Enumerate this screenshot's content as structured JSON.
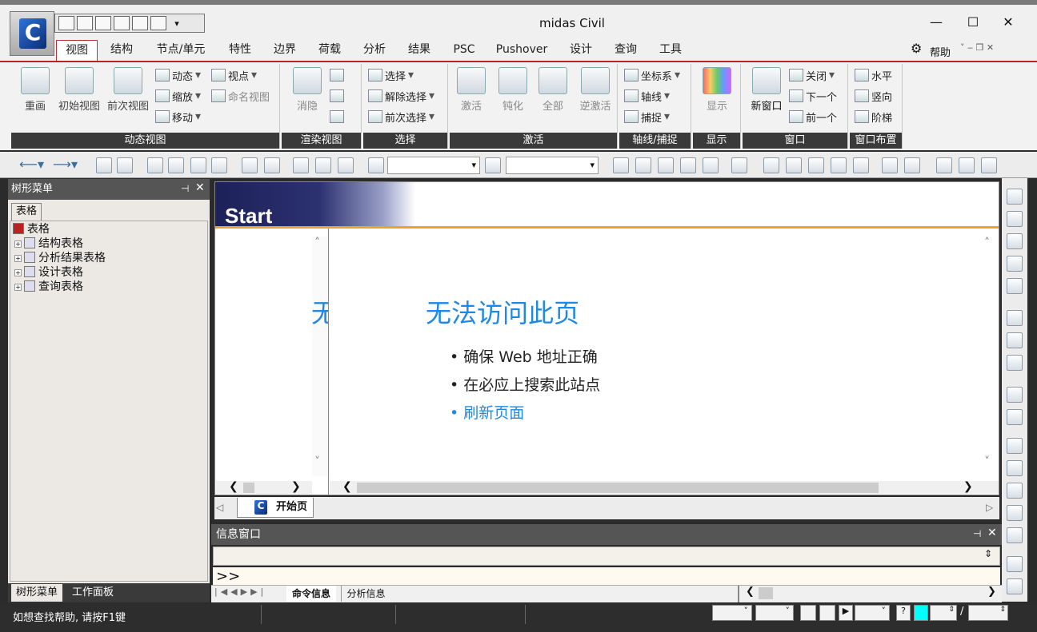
{
  "window": {
    "title": "midas Civil",
    "minimize": "—",
    "maximize": "☐",
    "close": "✕",
    "help_label": "帮助",
    "gear_glyph": "⚙"
  },
  "ribbon_tabs": [
    "视图",
    "结构",
    "节点/单元",
    "特性",
    "边界",
    "荷载",
    "分析",
    "结果",
    "PSC",
    "Pushover",
    "设计",
    "查询",
    "工具"
  ],
  "active_tab": "视图",
  "groups": {
    "dynamic_view": {
      "label": "动态视图",
      "buttons": [
        "重画",
        "初始视图",
        "前次视图"
      ],
      "small": [
        "动态",
        "缩放",
        "移动",
        "视点",
        "命名视图"
      ]
    },
    "render_view": {
      "label": "渲染视图",
      "buttons": [
        "消隐"
      ]
    },
    "select": {
      "label": "选择",
      "small": [
        "选择",
        "解除选择",
        "前次选择"
      ]
    },
    "activate": {
      "label": "激活",
      "buttons": [
        "激活",
        "钝化",
        "全部",
        "逆激活"
      ]
    },
    "axis_snap": {
      "label": "轴线/捕捉",
      "small": [
        "坐标系",
        "轴线",
        "捕捉"
      ]
    },
    "display": {
      "label": "显示",
      "buttons": [
        "显示"
      ]
    },
    "window": {
      "label": "窗口",
      "buttons": [
        "新窗口"
      ],
      "small": [
        "关闭",
        "下一个",
        "前一个"
      ]
    },
    "window_layout": {
      "label": "窗口布置",
      "small": [
        "水平",
        "竖向",
        "阶梯"
      ]
    }
  },
  "left_panel": {
    "title": "树形菜单",
    "tab": "表格",
    "tree": [
      "表格",
      "结构表格",
      "分析结果表格",
      "设计表格",
      "查询表格"
    ],
    "bottom_tabs": [
      "树形菜单",
      "工作面板"
    ]
  },
  "main": {
    "banner": "Start",
    "error_title": "无法访问此页",
    "error_title_clipped": "无",
    "bullets": [
      "确保 Web 地址正确",
      "在必应上搜索此站点",
      "刷新页面"
    ],
    "doc_tab": "开始页"
  },
  "info": {
    "title": "信息窗口",
    "prompt": ">>",
    "tabs": [
      "命令信息",
      "分析信息"
    ]
  },
  "status": {
    "text": "如想查找帮助, 请按F1键",
    "separator": "/"
  },
  "colors": {
    "accent": "#c02020",
    "link": "#1e88e5",
    "banner": "#1d2159"
  }
}
